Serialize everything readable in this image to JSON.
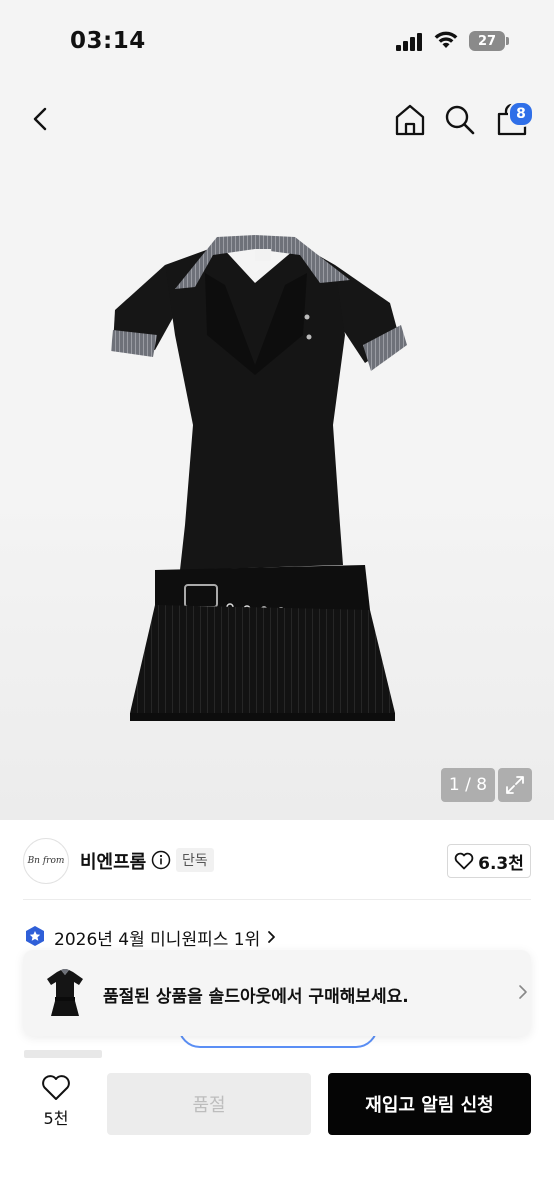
{
  "status_bar": {
    "time": "03:14",
    "battery": "27"
  },
  "nav": {
    "back_icon": "chevron-left-icon",
    "home_icon": "home-icon",
    "search_icon": "search-icon",
    "cart_icon": "shopping-bag-icon",
    "cart_count": "8",
    "badge_color": "#2f6fe8"
  },
  "gallery": {
    "counter": "1 / 8",
    "expand_icon": "expand-icon"
  },
  "brand": {
    "logo_text": "Bn from",
    "name": "비엔프롬",
    "exclusive_badge": "단독",
    "like_count": "6.3천"
  },
  "ranking": {
    "text": "2026년 4월 미니원피스 1위",
    "badge_color": "#2f5fd8"
  },
  "toast": {
    "message": "품절된 상품을 솔드아웃에서 구매해보세요."
  },
  "bottom_bar": {
    "wish_count": "5천",
    "soldout_label": "품절",
    "notify_label": "재입고 알림 신청"
  }
}
